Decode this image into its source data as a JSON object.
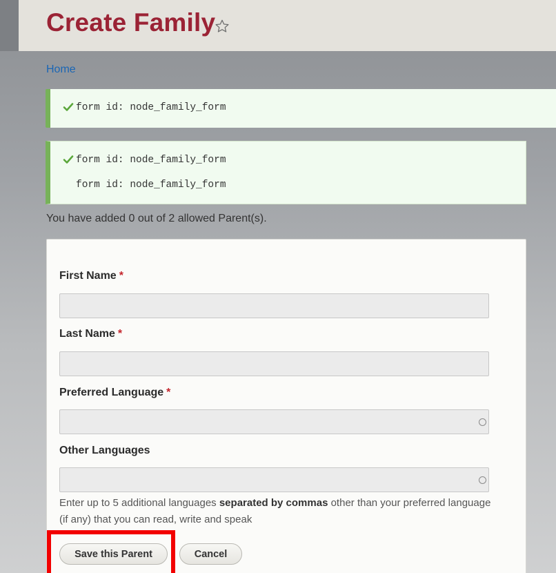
{
  "header": {
    "title": "Create Family",
    "star_icon": "star-outline-icon"
  },
  "breadcrumb": {
    "home": "Home"
  },
  "messages": [
    {
      "lines": [
        "form id: node_family_form"
      ],
      "icon": "check-icon"
    },
    {
      "lines": [
        "form id: node_family_form",
        "form id: node_family_form"
      ],
      "icon": "check-icon"
    }
  ],
  "notice": "You have added 0 out of 2 allowed Parent(s).",
  "form": {
    "first_name": {
      "label": "First Name",
      "required_mark": "*",
      "value": ""
    },
    "last_name": {
      "label": "Last Name",
      "required_mark": "*",
      "value": ""
    },
    "preferred_language": {
      "label": "Preferred Language",
      "required_mark": "*",
      "value": ""
    },
    "other_languages": {
      "label": "Other Languages",
      "value": ""
    },
    "help": {
      "before": "Enter up to 5 additional languages ",
      "bold": "separated by commas",
      "after": " other than your preferred language (if any) that you can read, write and speak"
    }
  },
  "actions": {
    "save_label": "Save this Parent",
    "cancel_label": "Cancel"
  },
  "colors": {
    "title": "#9b2335",
    "link": "#1a66b5",
    "success_border": "#77b259",
    "required": "#c4252c",
    "highlight": "#f20000"
  }
}
